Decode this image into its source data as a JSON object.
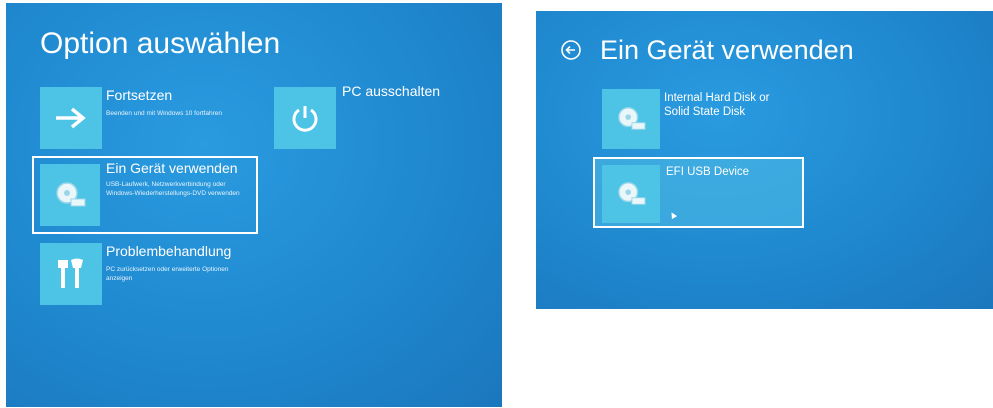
{
  "left_screen": {
    "title": "Option auswählen",
    "options": [
      {
        "title": "Fortsetzen",
        "description": "Beenden und mit Windows 10 fortfahren",
        "icon": "arrow-right-icon"
      },
      {
        "title": "PC ausschalten",
        "description": "",
        "icon": "power-icon"
      },
      {
        "title": "Ein Gerät verwenden",
        "description": "USB-Laufwerk, Netzwerkverbindung oder Windows-Wiederherstellungs-DVD verwenden",
        "icon": "disk-drive-icon"
      },
      {
        "title": "Problembehandlung",
        "description": "PC zurücksetzen oder erweiterte Optionen anzeigen",
        "icon": "tools-icon"
      }
    ]
  },
  "right_screen": {
    "title": "Ein Gerät verwenden",
    "back_icon": "back-arrow-icon",
    "devices": [
      {
        "label": "Internal Hard Disk or Solid State Disk",
        "icon": "disk-drive-icon"
      },
      {
        "label": "EFI USB Device",
        "icon": "disk-drive-icon"
      }
    ]
  },
  "colors": {
    "background": "#1f88cf",
    "tile": "#4dc4e6",
    "text": "#ffffff"
  }
}
